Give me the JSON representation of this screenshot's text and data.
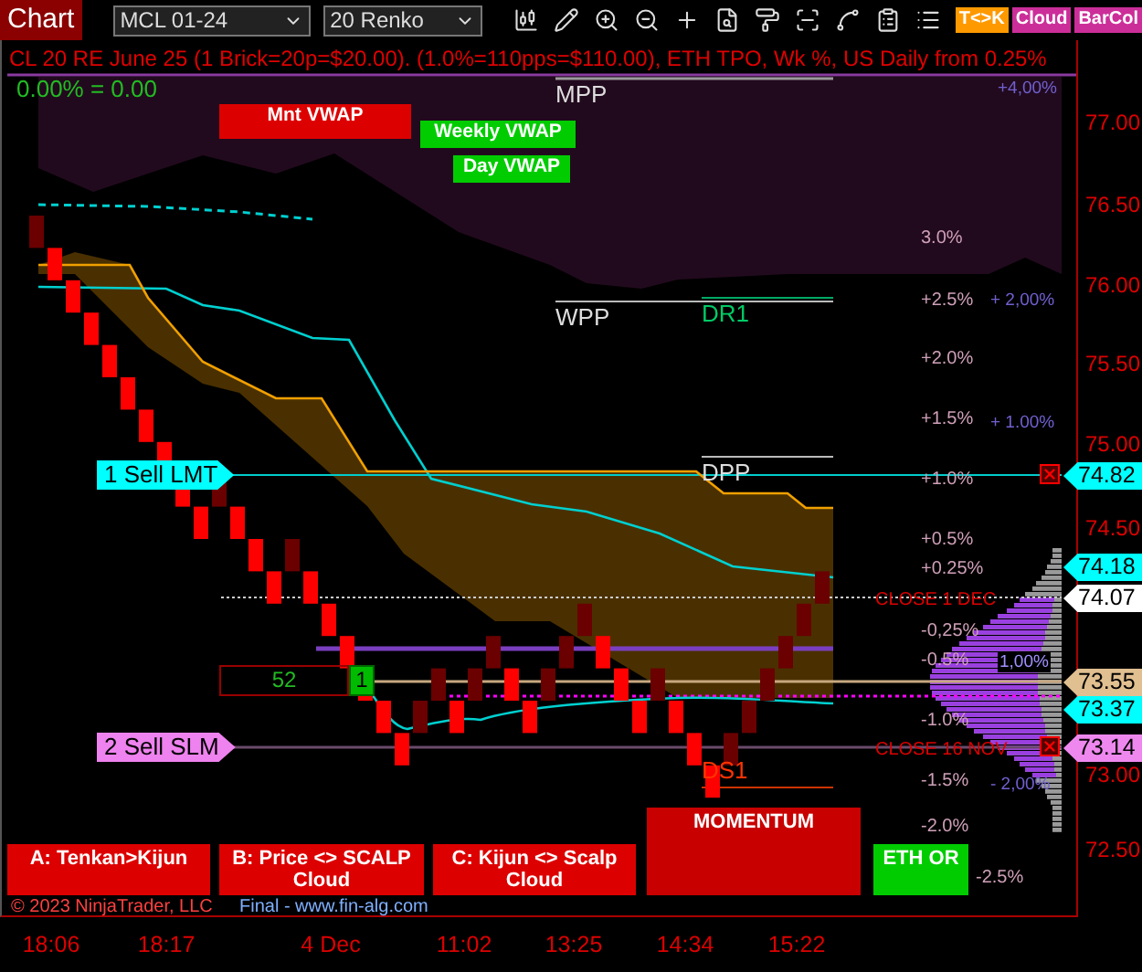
{
  "toolbar": {
    "title": "Chart",
    "instrument": "MCL 01-24",
    "bar_type": "20 Renko",
    "toggles": [
      {
        "label": "T<>K",
        "color": "#ff9900"
      },
      {
        "label": "Cloud",
        "color": "#cc2e99"
      },
      {
        "label": "BarCol",
        "color": "#cc2e99"
      }
    ]
  },
  "chart": {
    "header": "CL 20 RE June 25 (1 Brick=20p=$20.00). (1.0%=110pps=$110.00), ETH TPO, Wk %, US Daily from 0.25%",
    "offset": "0.00% = 0.00",
    "vwap_labels": [
      {
        "label": "Mnt VWAP",
        "color": "#dd0000"
      },
      {
        "label": "Weekly VWAP",
        "color": "#00cc00"
      },
      {
        "label": "Day VWAP",
        "color": "#00cc00"
      }
    ],
    "pivot_labels": [
      {
        "label": "MPP",
        "kind": "pivot"
      },
      {
        "label": "WPP",
        "kind": "pivot"
      },
      {
        "label": "DR1",
        "kind": "resistance"
      },
      {
        "label": "DPP",
        "kind": "pivot"
      },
      {
        "label": "DS1",
        "kind": "support"
      }
    ],
    "percent_labels": [
      {
        "label": "3.0%",
        "kind": "percent"
      },
      {
        "label": "+2.5%",
        "kind": "percent"
      },
      {
        "label": "+2.0%",
        "kind": "percent"
      },
      {
        "label": "+1.5%",
        "kind": "percent"
      },
      {
        "label": "+1.0%",
        "kind": "percent"
      },
      {
        "label": "+0.5%",
        "kind": "percent"
      },
      {
        "label": "+0.25%",
        "kind": "percent"
      },
      {
        "label": "CLOSE 1 DEC",
        "kind": "close"
      },
      {
        "label": "-0,25%",
        "kind": "percent"
      },
      {
        "label": "-0.5%",
        "kind": "percent"
      },
      {
        "label": "-1.0%",
        "kind": "percent"
      },
      {
        "label": "CLOSE 16 NOV",
        "kind": "close"
      },
      {
        "label": "-1.5%",
        "kind": "percent"
      },
      {
        "label": "-2.0%",
        "kind": "percent"
      },
      {
        "label": "-2.5%",
        "kind": "percent"
      }
    ],
    "weekly_percent_labels": [
      "+4,00%",
      "+ 2,00%",
      "+ 1.00%",
      "1,00%",
      "- 2,00%"
    ],
    "orders": [
      {
        "label": "1 Sell LMT",
        "color": "#00ffff"
      },
      {
        "label": "2 Sell SLM",
        "color": "#ee82ee"
      }
    ],
    "position": {
      "ticks": "52",
      "quantity": "1"
    },
    "signals": [
      {
        "label": "A: Tenkan>Kijun",
        "color": "#dd0000"
      },
      {
        "label": "B: Price <> SCALP Cloud",
        "color": "#dd0000"
      },
      {
        "label": "C: Kijun <> Scalp Cloud",
        "color": "#dd0000"
      },
      {
        "label": "MOMENTUM",
        "color": "#c80000"
      },
      {
        "label": "ETH OR",
        "color": "#00cc00"
      }
    ],
    "copyright": "© 2023 NinjaTrader, LLC",
    "credit": "Final - www.fin-alg.com"
  },
  "price_axis": {
    "ticks": [
      "77.00",
      "76.50",
      "76.00",
      "75.50",
      "75.00",
      "74.50",
      "73.00",
      "72.50"
    ],
    "flags": [
      {
        "value": "74.82",
        "color": "#00ffff"
      },
      {
        "value": "74.18",
        "color": "#00ffff"
      },
      {
        "value": "74.07",
        "color": "#ffffff"
      },
      {
        "value": "73.55",
        "color": "#e0bf90"
      },
      {
        "value": "73.37",
        "color": "#00ffff"
      },
      {
        "value": "73.14",
        "color": "#ee88ee"
      }
    ]
  },
  "time_axis": {
    "ticks": [
      "18:06",
      "18:17",
      "4 Dec",
      "11:02",
      "13:25",
      "14:34",
      "15:22"
    ]
  }
}
